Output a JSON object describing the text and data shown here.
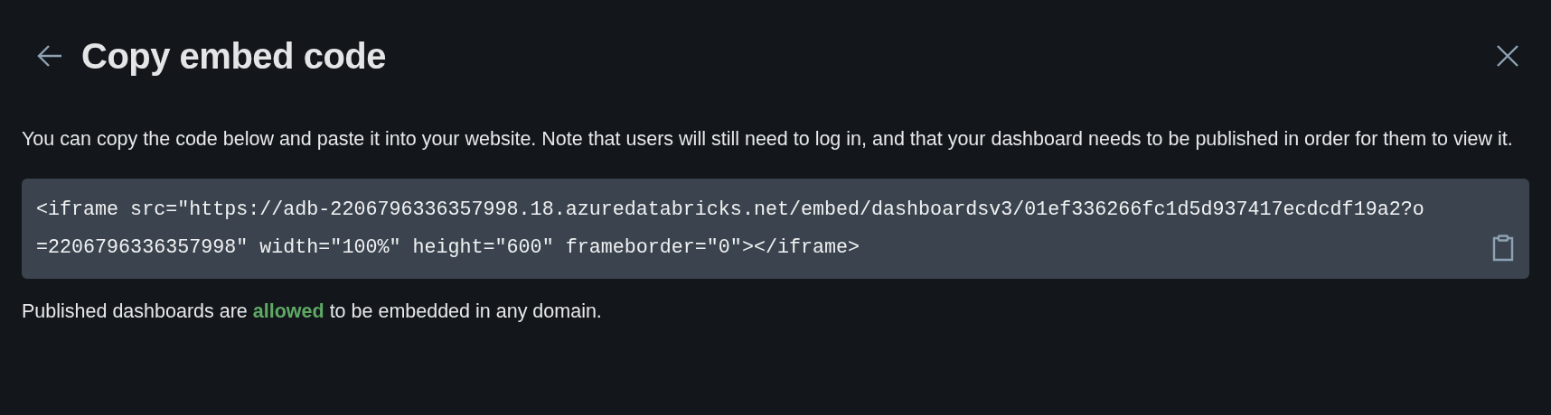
{
  "dialog": {
    "title": "Copy embed code",
    "description": "You can copy the code below and paste it into your website. Note that users will still need to log in, and that your dashboard needs to be published in order for them to view it.",
    "code": "<iframe src=\"https://adb-2206796336357998.18.azuredatabricks.net/embed/dashboardsv3/01ef336266fc1d5d937417ecdcdf19a2?o=2206796336357998\" width=\"100%\" height=\"600\" frameborder=\"0\"></iframe>",
    "note": [
      {
        "text": "Published dashboards are ",
        "kind": "plain"
      },
      {
        "text": "allowed",
        "kind": "status",
        "color": "#5fa965"
      },
      {
        "text": " to be embedded in any domain.",
        "kind": "plain"
      }
    ]
  }
}
